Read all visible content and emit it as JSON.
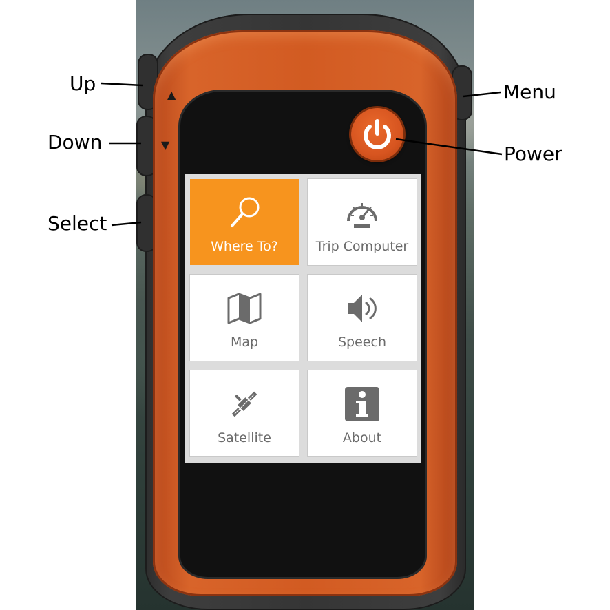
{
  "device": {
    "colors": {
      "body_orange": "#d25b22",
      "tile_active": "#f7941e",
      "tile_text": "#6b6b6b"
    },
    "up_arrow_glyph": "▲",
    "down_arrow_glyph": "▼",
    "power_icon": "power-icon"
  },
  "callouts": {
    "up": "Up",
    "down": "Down",
    "select": "Select",
    "menu": "Menu",
    "power": "Power"
  },
  "menu": {
    "tiles": [
      {
        "label": "Where To?",
        "icon": "search-icon",
        "active": true
      },
      {
        "label": "Trip Computer",
        "icon": "speedometer-icon",
        "active": false
      },
      {
        "label": "Map",
        "icon": "map-icon",
        "active": false
      },
      {
        "label": "Speech",
        "icon": "speaker-icon",
        "active": false
      },
      {
        "label": "Satellite",
        "icon": "satellite-icon",
        "active": false
      },
      {
        "label": "About",
        "icon": "info-icon",
        "active": false
      }
    ]
  }
}
